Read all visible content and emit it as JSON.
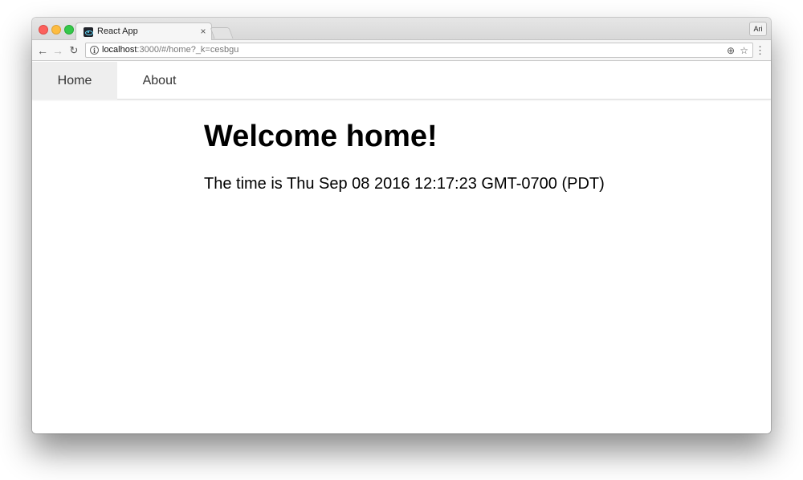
{
  "browser": {
    "tab_title": "React App",
    "tab_close": "×",
    "profile": "Ari",
    "url_host": "localhost",
    "url_rest": ":3000/#/home?_k=cesbgu"
  },
  "navbar": {
    "items": [
      {
        "label": "Home",
        "active": true
      },
      {
        "label": "About",
        "active": false
      }
    ]
  },
  "main": {
    "heading": "Welcome home!",
    "time_text": "The time is Thu Sep 08 2016 12:17:23 GMT-0700 (PDT)"
  },
  "colors": {
    "active_nav_bg": "#eeeeee",
    "text": "#000000"
  }
}
